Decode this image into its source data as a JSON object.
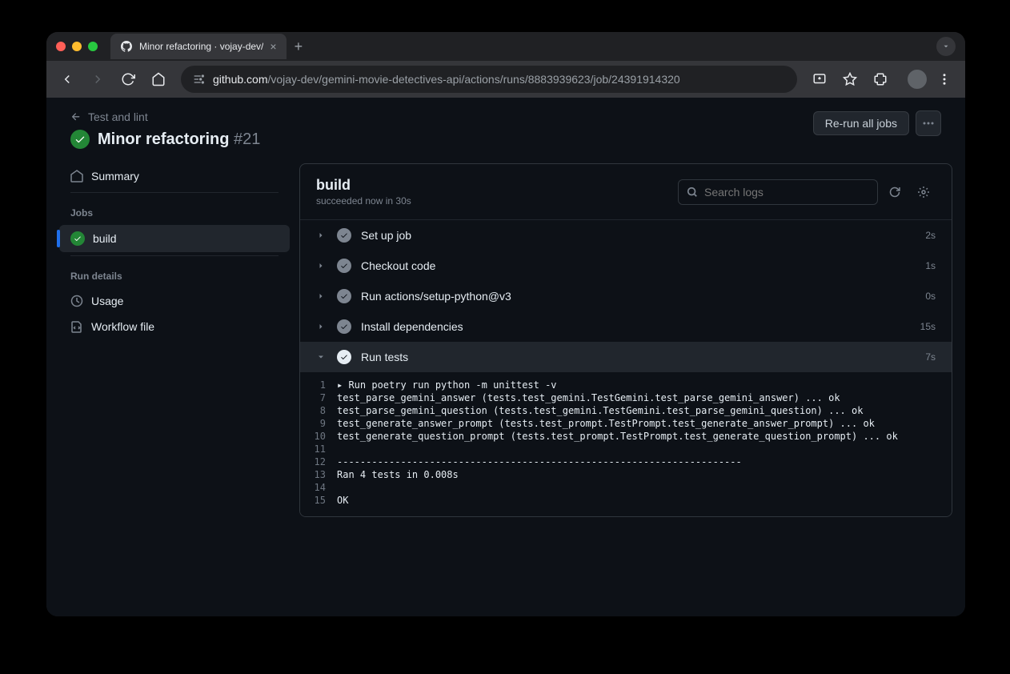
{
  "browser": {
    "tab_title": "Minor refactoring · vojay-dev/",
    "url_domain": "github.com",
    "url_path": "/vojay-dev/gemini-movie-detectives-api/actions/runs/8883939623/job/24391914320"
  },
  "header": {
    "back_link": "Test and lint",
    "title": "Minor refactoring",
    "run_number": "#21",
    "rerun_button": "Re-run all jobs"
  },
  "sidebar": {
    "summary": "Summary",
    "jobs_heading": "Jobs",
    "job_name": "build",
    "run_details_heading": "Run details",
    "usage": "Usage",
    "workflow_file": "Workflow file"
  },
  "job": {
    "title": "build",
    "status": "succeeded now in 30s",
    "search_placeholder": "Search logs"
  },
  "steps": [
    {
      "name": "Set up job",
      "duration": "2s",
      "expanded": false
    },
    {
      "name": "Checkout code",
      "duration": "1s",
      "expanded": false
    },
    {
      "name": "Run actions/setup-python@v3",
      "duration": "0s",
      "expanded": false
    },
    {
      "name": "Install dependencies",
      "duration": "15s",
      "expanded": false
    },
    {
      "name": "Run tests",
      "duration": "7s",
      "expanded": true
    }
  ],
  "log_lines": [
    {
      "n": "1",
      "text": "▸ Run poetry run python -m unittest -v",
      "caret": true
    },
    {
      "n": "7",
      "text": "test_parse_gemini_answer (tests.test_gemini.TestGemini.test_parse_gemini_answer) ... ok"
    },
    {
      "n": "8",
      "text": "test_parse_gemini_question (tests.test_gemini.TestGemini.test_parse_gemini_question) ... ok"
    },
    {
      "n": "9",
      "text": "test_generate_answer_prompt (tests.test_prompt.TestPrompt.test_generate_answer_prompt) ... ok"
    },
    {
      "n": "10",
      "text": "test_generate_question_prompt (tests.test_prompt.TestPrompt.test_generate_question_prompt) ... ok"
    },
    {
      "n": "11",
      "text": ""
    },
    {
      "n": "12",
      "text": "----------------------------------------------------------------------"
    },
    {
      "n": "13",
      "text": "Ran 4 tests in 0.008s"
    },
    {
      "n": "14",
      "text": ""
    },
    {
      "n": "15",
      "text": "OK"
    }
  ]
}
